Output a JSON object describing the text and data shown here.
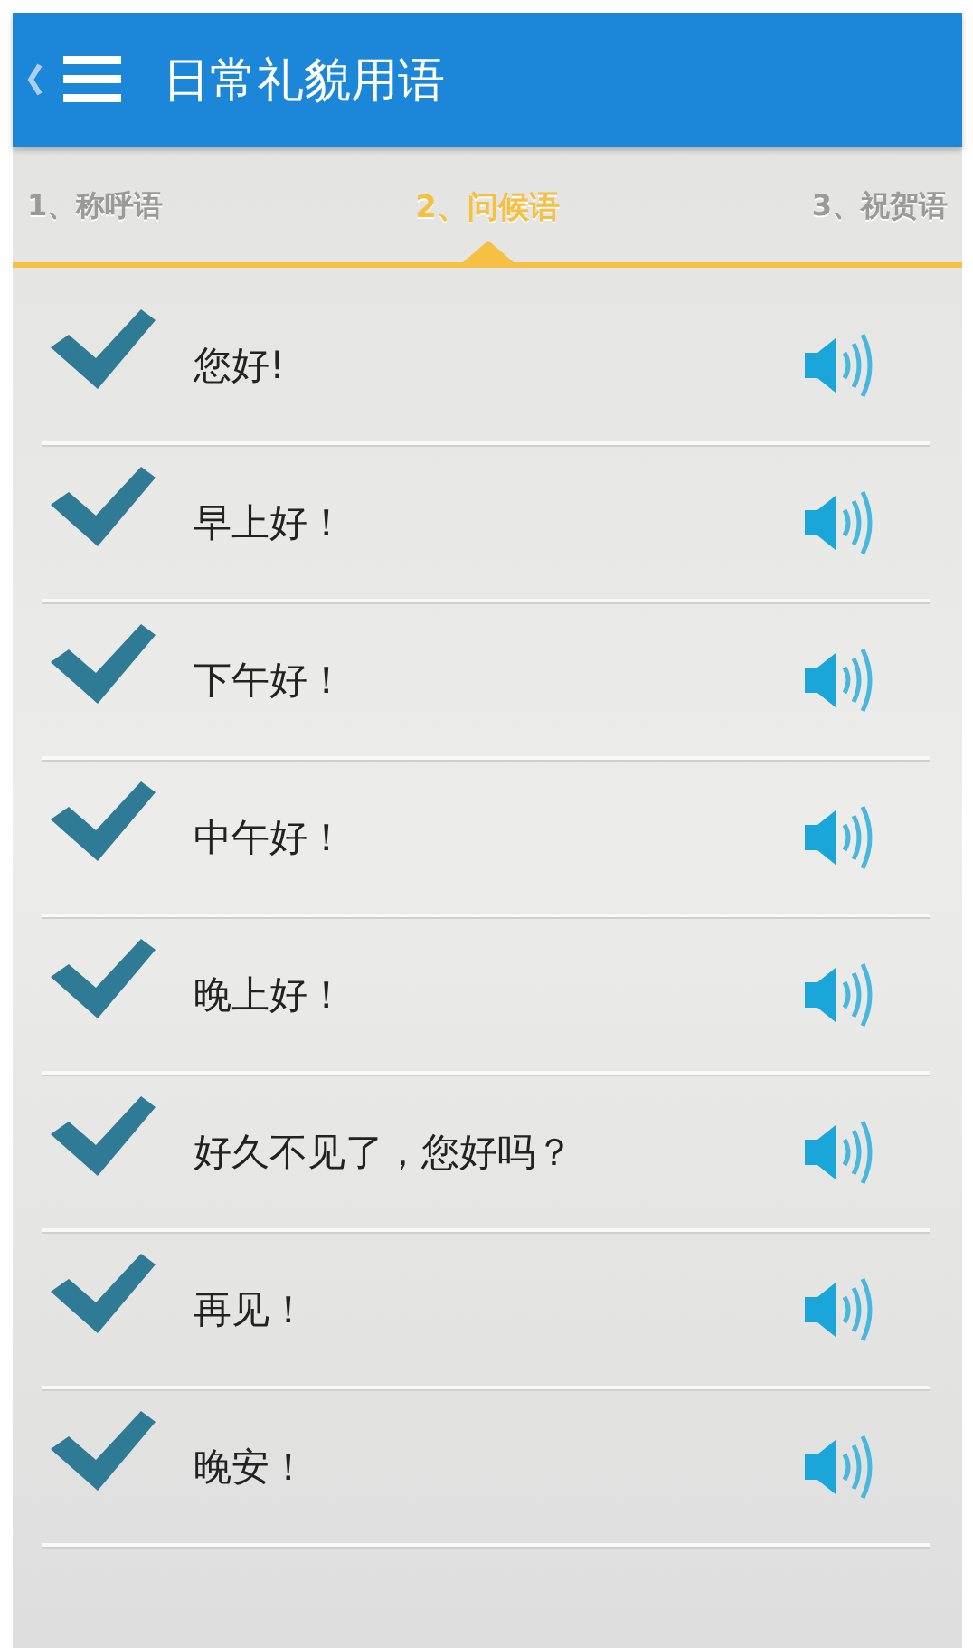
{
  "header": {
    "title": "日常礼貌用语"
  },
  "tabs": [
    {
      "label": "1、称呼语",
      "selected": false
    },
    {
      "label": "2、问候语",
      "selected": true
    },
    {
      "label": "3、祝贺语",
      "selected": false
    }
  ],
  "phrases": [
    {
      "text": "您好!",
      "checked": true
    },
    {
      "text": "早上好！",
      "checked": true
    },
    {
      "text": "下午好！",
      "checked": true
    },
    {
      "text": "中午好！",
      "checked": true
    },
    {
      "text": "晚上好！",
      "checked": true
    },
    {
      "text": "好久不见了，您好吗？",
      "checked": true
    },
    {
      "text": "再见！",
      "checked": true
    },
    {
      "text": "晚安！",
      "checked": true
    }
  ]
}
